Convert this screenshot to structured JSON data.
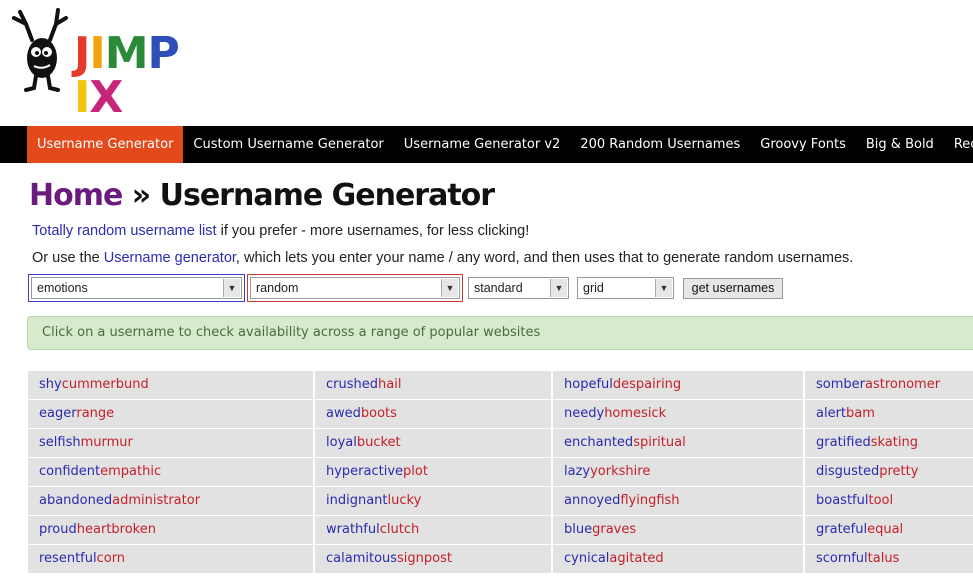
{
  "logo": {
    "letters": [
      {
        "ch": "J",
        "color": "#e53a2a"
      },
      {
        "ch": "I",
        "color": "#f2a20b"
      },
      {
        "ch": "M",
        "color": "#2a8a3a"
      },
      {
        "ch": "P",
        "color": "#2e4fb8"
      },
      {
        "ch": "I",
        "color": "#f2c40b"
      },
      {
        "ch": "X",
        "color": "#c8247a"
      }
    ]
  },
  "nav": {
    "items": [
      {
        "label": "Username Generator",
        "active": true
      },
      {
        "label": "Custom Username Generator"
      },
      {
        "label": "Username Generator v2"
      },
      {
        "label": "200 Random Usernames"
      },
      {
        "label": "Groovy Fonts"
      },
      {
        "label": "Big & Bold"
      },
      {
        "label": "Recent"
      }
    ]
  },
  "heading": {
    "home": "Home",
    "sep": " » ",
    "title": "Username Generator"
  },
  "intro": {
    "line1_link": "Totally random username list",
    "line1_rest": " if you prefer - more usernames, for less clicking!",
    "line2_pre": "Or use the ",
    "line2_link": "Username generator",
    "line2_rest": ", which lets you enter your name / any word, and then uses that to generate random usernames."
  },
  "controls": {
    "category": "emotions",
    "mode": "random",
    "style": "standard",
    "layout": "grid",
    "submit": "get usernames"
  },
  "banner": "Click on a username to check availability across a range of popular websites",
  "usernames": [
    [
      [
        "shy",
        "cummerbund"
      ],
      [
        "eager",
        "range"
      ],
      [
        "selfish",
        "murmur"
      ],
      [
        "confident",
        "empathic"
      ],
      [
        "abandoned",
        "administrator"
      ],
      [
        "proud",
        "heartbroken"
      ],
      [
        "resentful",
        "corn"
      ]
    ],
    [
      [
        "crushed",
        "hail"
      ],
      [
        "awed",
        "boots"
      ],
      [
        "loyal",
        "bucket"
      ],
      [
        "hyperactive",
        "plot"
      ],
      [
        "indignant",
        "lucky"
      ],
      [
        "wrathful",
        "clutch"
      ],
      [
        "calamitous",
        "signpost"
      ]
    ],
    [
      [
        "hopeful",
        "despairing"
      ],
      [
        "needy",
        "homesick"
      ],
      [
        "enchanted",
        "spiritual"
      ],
      [
        "lazy",
        "yorkshire"
      ],
      [
        "annoyed",
        "flyingfish"
      ],
      [
        "blue",
        "graves"
      ],
      [
        "cynical",
        "agitated"
      ]
    ],
    [
      [
        "somber",
        "astronomer"
      ],
      [
        "alert",
        "bam"
      ],
      [
        "gratified",
        "skating"
      ],
      [
        "disgusted",
        "pretty"
      ],
      [
        "boastful",
        "tool"
      ],
      [
        "grateful",
        "equal"
      ],
      [
        "scornful",
        "talus"
      ]
    ]
  ]
}
